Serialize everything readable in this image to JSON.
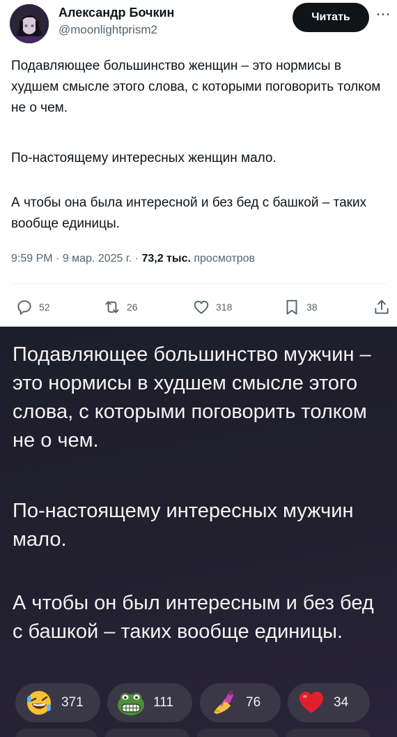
{
  "tweet": {
    "author": {
      "name": "Александр Бочкин",
      "handle": "@moonlightprism2"
    },
    "follow_label": "Читать",
    "more_label": "···",
    "paragraphs": [
      "Подавляющее большинство женщин – это нормисы в худшем смысле этого слова, с которыми поговорить толком не о чем.",
      "По-настоящему интересных женщин мало.",
      "А чтобы она была интересной и без бед с башкой – таких вообще единицы."
    ],
    "time": "9:59 PM",
    "date": "9 мар. 2025 г.",
    "separator": "·",
    "views_count": "73,2 тыс.",
    "views_label": "просмотров",
    "actions": {
      "replies": "52",
      "reposts": "26",
      "likes": "318",
      "bookmarks": "38"
    },
    "icons": [
      "reply-icon",
      "repost-icon",
      "heart-icon",
      "bookmark-icon",
      "share-icon"
    ]
  },
  "message": {
    "paragraphs": [
      "Подавляющее большинство мужчин – это нормисы в худшем смысле этого слова, с которыми поговорить толком не о чем.",
      "По-настоящему интересных мужчин мало.",
      "А чтобы он был интересным и без бед с башкой – таких вообще единицы."
    ],
    "reactions": [
      {
        "emoji": "rofl-emoji",
        "count": "371"
      },
      {
        "emoji": "pepe-emoji",
        "count": "111"
      },
      {
        "emoji": "nail-polish-emoji",
        "count": "76"
      },
      {
        "emoji": "heart-emoji",
        "count": "34"
      }
    ]
  },
  "colors": {
    "text_primary": "#0f1419",
    "text_secondary": "#536471",
    "dark_bg": "#22202f",
    "reaction_bg": "#3a3746",
    "heart_red": "#e0202c"
  }
}
